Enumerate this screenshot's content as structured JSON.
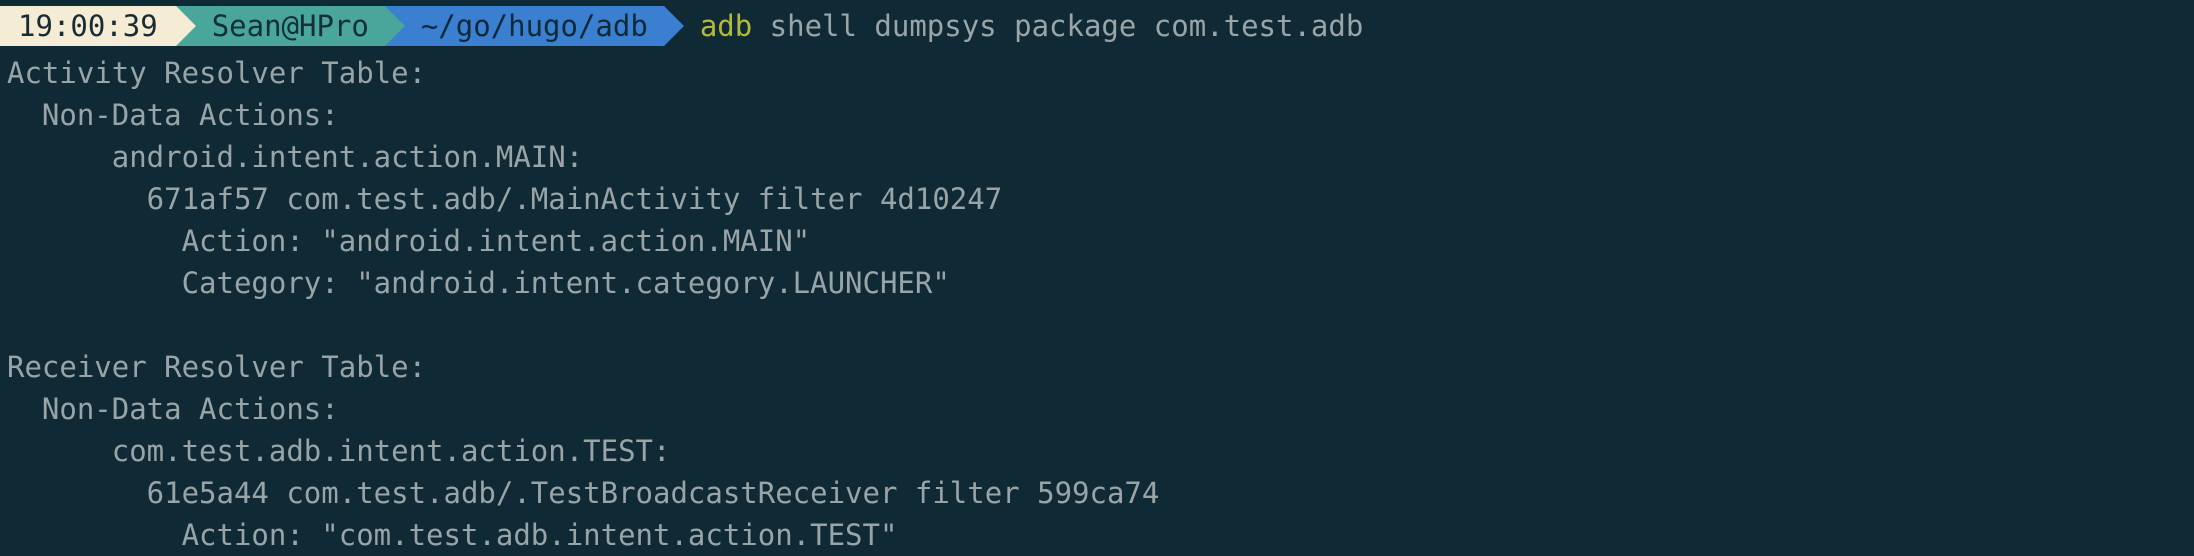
{
  "prompt": {
    "time": "19:00:39",
    "user": "Sean@HPro",
    "path": "~/go/hugo/adb",
    "command_name": "adb",
    "command_args": "shell dumpsys package com.test.adb"
  },
  "colors": {
    "background": "#0f2a35",
    "text": "#98a4a6",
    "time_segment": "#f5ecd5",
    "user_segment": "#4aa59a",
    "path_segment": "#3b7fd0",
    "command": "#b5b93a"
  },
  "output": [
    "Activity Resolver Table:",
    "  Non-Data Actions:",
    "      android.intent.action.MAIN:",
    "        671af57 com.test.adb/.MainActivity filter 4d10247",
    "          Action: \"android.intent.action.MAIN\"",
    "          Category: \"android.intent.category.LAUNCHER\"",
    "",
    "Receiver Resolver Table:",
    "  Non-Data Actions:",
    "      com.test.adb.intent.action.TEST:",
    "        61e5a44 com.test.adb/.TestBroadcastReceiver filter 599ca74",
    "          Action: \"com.test.adb.intent.action.TEST\""
  ]
}
